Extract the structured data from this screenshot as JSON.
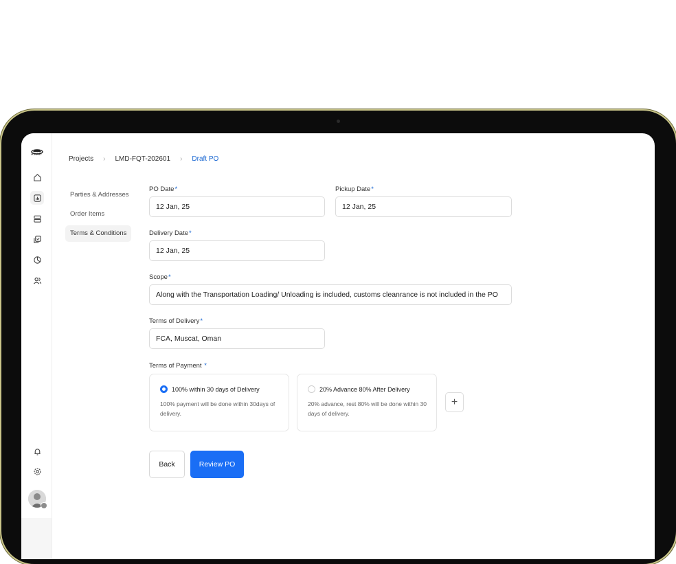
{
  "brand": {
    "logo_text": "AMAD"
  },
  "breadcrumb": [
    "Projects",
    "LMD-FQT-202601",
    "Draft PO"
  ],
  "subnav": [
    "Parties & Addresses",
    "Order Items",
    "Terms & Conditions"
  ],
  "form": {
    "po_date": {
      "label": "PO Date",
      "value": "12 Jan, 25"
    },
    "pickup_date": {
      "label": "Pickup Date",
      "value": "12 Jan, 25"
    },
    "delivery_date": {
      "label": "Delivery Date",
      "value": "12 Jan, 25"
    },
    "scope": {
      "label": "Scope",
      "value": "Along with the Transportation Loading/ Unloading is included, customs cleanrance is not included in the PO"
    },
    "terms_delivery": {
      "label": "Terms of Delivery",
      "value": "FCA, Muscat, Oman"
    },
    "terms_payment": {
      "label": "Terms of Payment"
    },
    "required_mark": "*"
  },
  "payment_options": [
    {
      "title": "100% within 30 days of Delivery",
      "desc": "100% payment will be done within 30days of delivery.",
      "selected": true
    },
    {
      "title": "20% Advance 80% After Delivery",
      "desc": "20% advance, rest 80% will be done within 30 days of delivery.",
      "selected": false
    }
  ],
  "buttons": {
    "back": "Back",
    "review": "Review PO",
    "add": "+"
  },
  "colors": {
    "accent": "#1a6ef5",
    "link": "#1967d2",
    "frame": "#0c0c0c"
  },
  "icons": [
    "home-icon",
    "chart-icon",
    "layers-icon",
    "clipboard-check-icon",
    "pie-chart-icon",
    "users-icon",
    "bell-icon",
    "gear-icon"
  ]
}
